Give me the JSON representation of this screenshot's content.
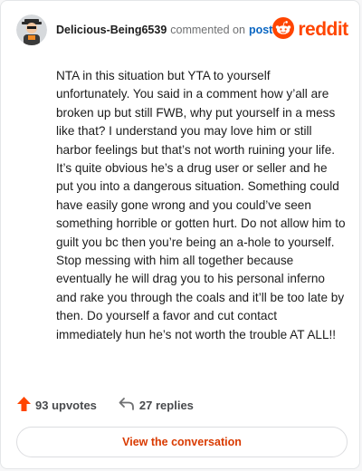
{
  "header": {
    "username": "Delicious-Being6539",
    "action_text": "commented on",
    "post_link": "post",
    "brand": "reddit"
  },
  "comment": {
    "text": "NTA in this situation but YTA to yourself unfortunately. You said in a comment how y’all are broken up but still FWB, why put yourself in a mess like that? I understand you may love him or still harbor feelings but that’s not worth ruining your life. It’s quite obvious he’s a drug user or seller and he put you into a dangerous situation. Something could have easily gone wrong and you could’ve seen something horrible or gotten hurt. Do not allow him to guilt you bc then you’re being an a-hole to yourself. Stop messing with him all together because eventually he will drag you to his personal inferno and rake you through the coals and it’ll be too late by then. Do yourself a favor and cut contact immediately hun he’s not worth the trouble AT ALL!!"
  },
  "stats": {
    "upvotes": "93 upvotes",
    "replies": "27 replies"
  },
  "cta": {
    "label": "View the conversation"
  },
  "icons": {
    "avatar": "avatar-icon",
    "reddit_logo": "reddit-snoo-icon",
    "upvote": "upvote-arrow-icon",
    "reply": "reply-arrow-icon"
  },
  "colors": {
    "brand": "#ff4500",
    "link": "#0a66c2",
    "cta_text": "#d93a00"
  }
}
